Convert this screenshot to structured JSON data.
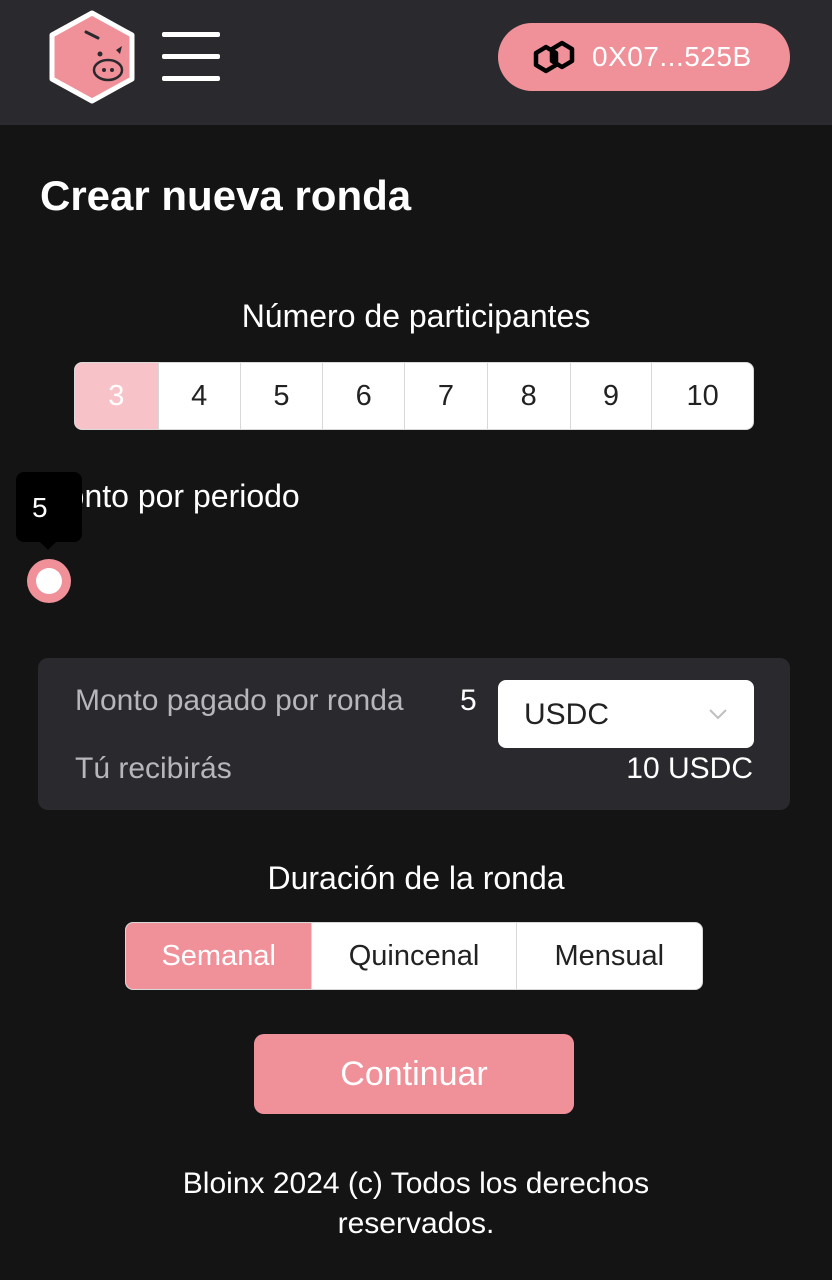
{
  "header": {
    "wallet_address": "0X07...525B"
  },
  "page": {
    "title": "Crear nueva ronda"
  },
  "participants": {
    "label": "Número de participantes",
    "options": [
      "3",
      "4",
      "5",
      "6",
      "7",
      "8",
      "9",
      "10"
    ],
    "selected": "3"
  },
  "amount": {
    "label": "Monto por periodo",
    "slider_value": "5"
  },
  "summary": {
    "paid_label": "Monto pagado por ronda",
    "paid_value": "5",
    "currency": "USDC",
    "receive_label": "Tú recibirás",
    "receive_value": "10 USDC"
  },
  "duration": {
    "label": "Duración de la ronda",
    "options": [
      "Semanal",
      "Quincenal",
      "Mensual"
    ],
    "selected": "Semanal"
  },
  "actions": {
    "continue_label": "Continuar"
  },
  "footer": {
    "line1": "Bloinx 2024 (c) Todos los derechos",
    "line2": "reservados."
  },
  "colors": {
    "accent": "#f0919a",
    "accent_light": "#f7c3c8",
    "background": "#141415",
    "panel": "#2a2a2e"
  }
}
